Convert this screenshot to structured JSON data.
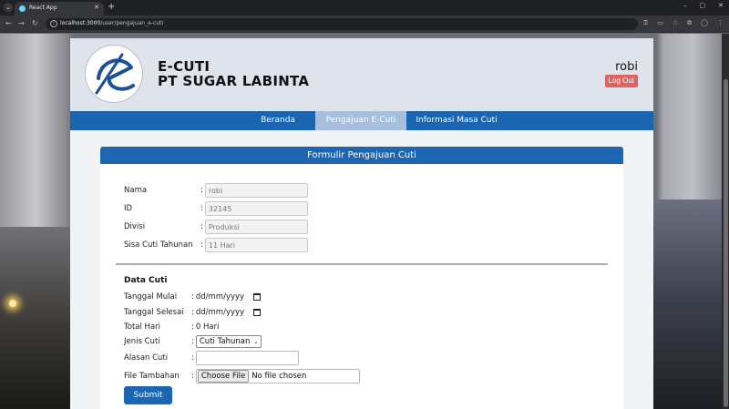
{
  "browser": {
    "tab_title": "React App",
    "new_tab_symbol": "+",
    "url_host": "localhost:3000",
    "url_path": "/user/pengajuan_e-cuti",
    "window_controls": [
      "–",
      "▢",
      "✕"
    ]
  },
  "header": {
    "brand_line1": "E-CUTI",
    "brand_line2": "PT SUGAR LABINTA",
    "user_name": "robi",
    "logout_label": "Log Out"
  },
  "nav": {
    "items": [
      {
        "label": "Beranda",
        "active": false
      },
      {
        "label": "Pengajuan E-Cuti",
        "active": true
      },
      {
        "label": "Informasi Masa Cuti",
        "active": false
      }
    ]
  },
  "form": {
    "title": "Formulir Pengajuan Cuti",
    "colon": ":",
    "employee": [
      {
        "label": "Nama",
        "value": "robi"
      },
      {
        "label": "ID",
        "value": "32145"
      },
      {
        "label": "Divisi",
        "value": "Produksi"
      },
      {
        "label": "Sisa Cuti Tahunan",
        "value": "11 Hari"
      }
    ],
    "section_title": "Data Cuti",
    "start_date": {
      "label": "Tanggal Mulai",
      "placeholder": "dd/mm/yyyy"
    },
    "end_date": {
      "label": "Tanggal Selesai",
      "placeholder": "dd/mm/yyyy"
    },
    "total_days": {
      "label": "Total Hari",
      "value": "0 Hari"
    },
    "leave_type": {
      "label": "Jenis Cuti",
      "selected": "Cuti Tahunan"
    },
    "reason": {
      "label": "Alasan Cuti",
      "value": ""
    },
    "attachment": {
      "label": "File Tambahan",
      "button": "Choose File",
      "status": "No file chosen"
    },
    "submit_label": "Submit"
  },
  "colors": {
    "nav_blue": "#1a64b0",
    "nav_active": "#a7bfdc",
    "logout_red": "#e06262",
    "header_bg": "#dfe4ec"
  }
}
